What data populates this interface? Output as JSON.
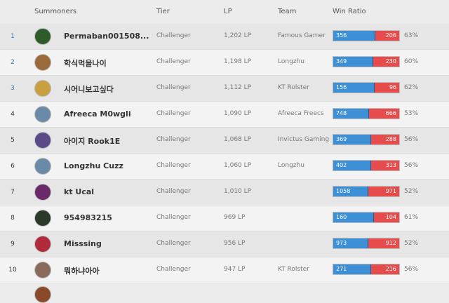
{
  "headers": {
    "summoners": "Summoners",
    "tier": "Tier",
    "lp": "LP",
    "team": "Team",
    "win_ratio": "Win Ratio"
  },
  "rows": [
    {
      "rank": "1",
      "rank_color": "blue",
      "name": "Permaban001508...",
      "tier": "Challenger",
      "lp": "1,202 LP",
      "team": "Famous Gamer",
      "wins": "356",
      "losses": "206",
      "ratio": "63%",
      "win_fraction": 0.63,
      "avatar_color": "#2f5b2a"
    },
    {
      "rank": "2",
      "rank_color": "blue",
      "name": "학식먹을나이",
      "tier": "Challenger",
      "lp": "1,198 LP",
      "team": "Longzhu",
      "wins": "349",
      "losses": "230",
      "ratio": "60%",
      "win_fraction": 0.6,
      "avatar_color": "#9a6a3a"
    },
    {
      "rank": "3",
      "rank_color": "blue",
      "name": "시어니보고싶다",
      "tier": "Challenger",
      "lp": "1,112 LP",
      "team": "KT Rolster",
      "wins": "156",
      "losses": "96",
      "ratio": "62%",
      "win_fraction": 0.62,
      "avatar_color": "#c8a040"
    },
    {
      "rank": "4",
      "rank_color": "black",
      "name": "Afreeca M0wgli",
      "tier": "Challenger",
      "lp": "1,090 LP",
      "team": "Afreeca Freecs",
      "wins": "748",
      "losses": "666",
      "ratio": "53%",
      "win_fraction": 0.53,
      "avatar_color": "#6a8aa8"
    },
    {
      "rank": "5",
      "rank_color": "black",
      "name": "아이지 Rook1E",
      "tier": "Challenger",
      "lp": "1,068 LP",
      "team": "Invictus Gaming",
      "wins": "369",
      "losses": "288",
      "ratio": "56%",
      "win_fraction": 0.56,
      "avatar_color": "#5a4a8a"
    },
    {
      "rank": "6",
      "rank_color": "black",
      "name": "Longzhu Cuzz",
      "tier": "Challenger",
      "lp": "1,060 LP",
      "team": "Longzhu",
      "wins": "402",
      "losses": "313",
      "ratio": "56%",
      "win_fraction": 0.56,
      "avatar_color": "#6a8aa8"
    },
    {
      "rank": "7",
      "rank_color": "black",
      "name": "kt Ucal",
      "tier": "Challenger",
      "lp": "1,010 LP",
      "team": "",
      "wins": "1058",
      "losses": "971",
      "ratio": "52%",
      "win_fraction": 0.52,
      "avatar_color": "#6a2a6a"
    },
    {
      "rank": "8",
      "rank_color": "black",
      "name": "954983215",
      "tier": "Challenger",
      "lp": "969 LP",
      "team": "",
      "wins": "160",
      "losses": "104",
      "ratio": "61%",
      "win_fraction": 0.61,
      "avatar_color": "#2a3a2a"
    },
    {
      "rank": "9",
      "rank_color": "black",
      "name": "Misssing",
      "tier": "Challenger",
      "lp": "956 LP",
      "team": "",
      "wins": "973",
      "losses": "912",
      "ratio": "52%",
      "win_fraction": 0.52,
      "avatar_color": "#b02a3a"
    },
    {
      "rank": "10",
      "rank_color": "black",
      "name": "뭐하냐아아",
      "tier": "Challenger",
      "lp": "947 LP",
      "team": "KT Rolster",
      "wins": "271",
      "losses": "216",
      "ratio": "56%",
      "win_fraction": 0.56,
      "avatar_color": "#8a6a5a"
    }
  ]
}
